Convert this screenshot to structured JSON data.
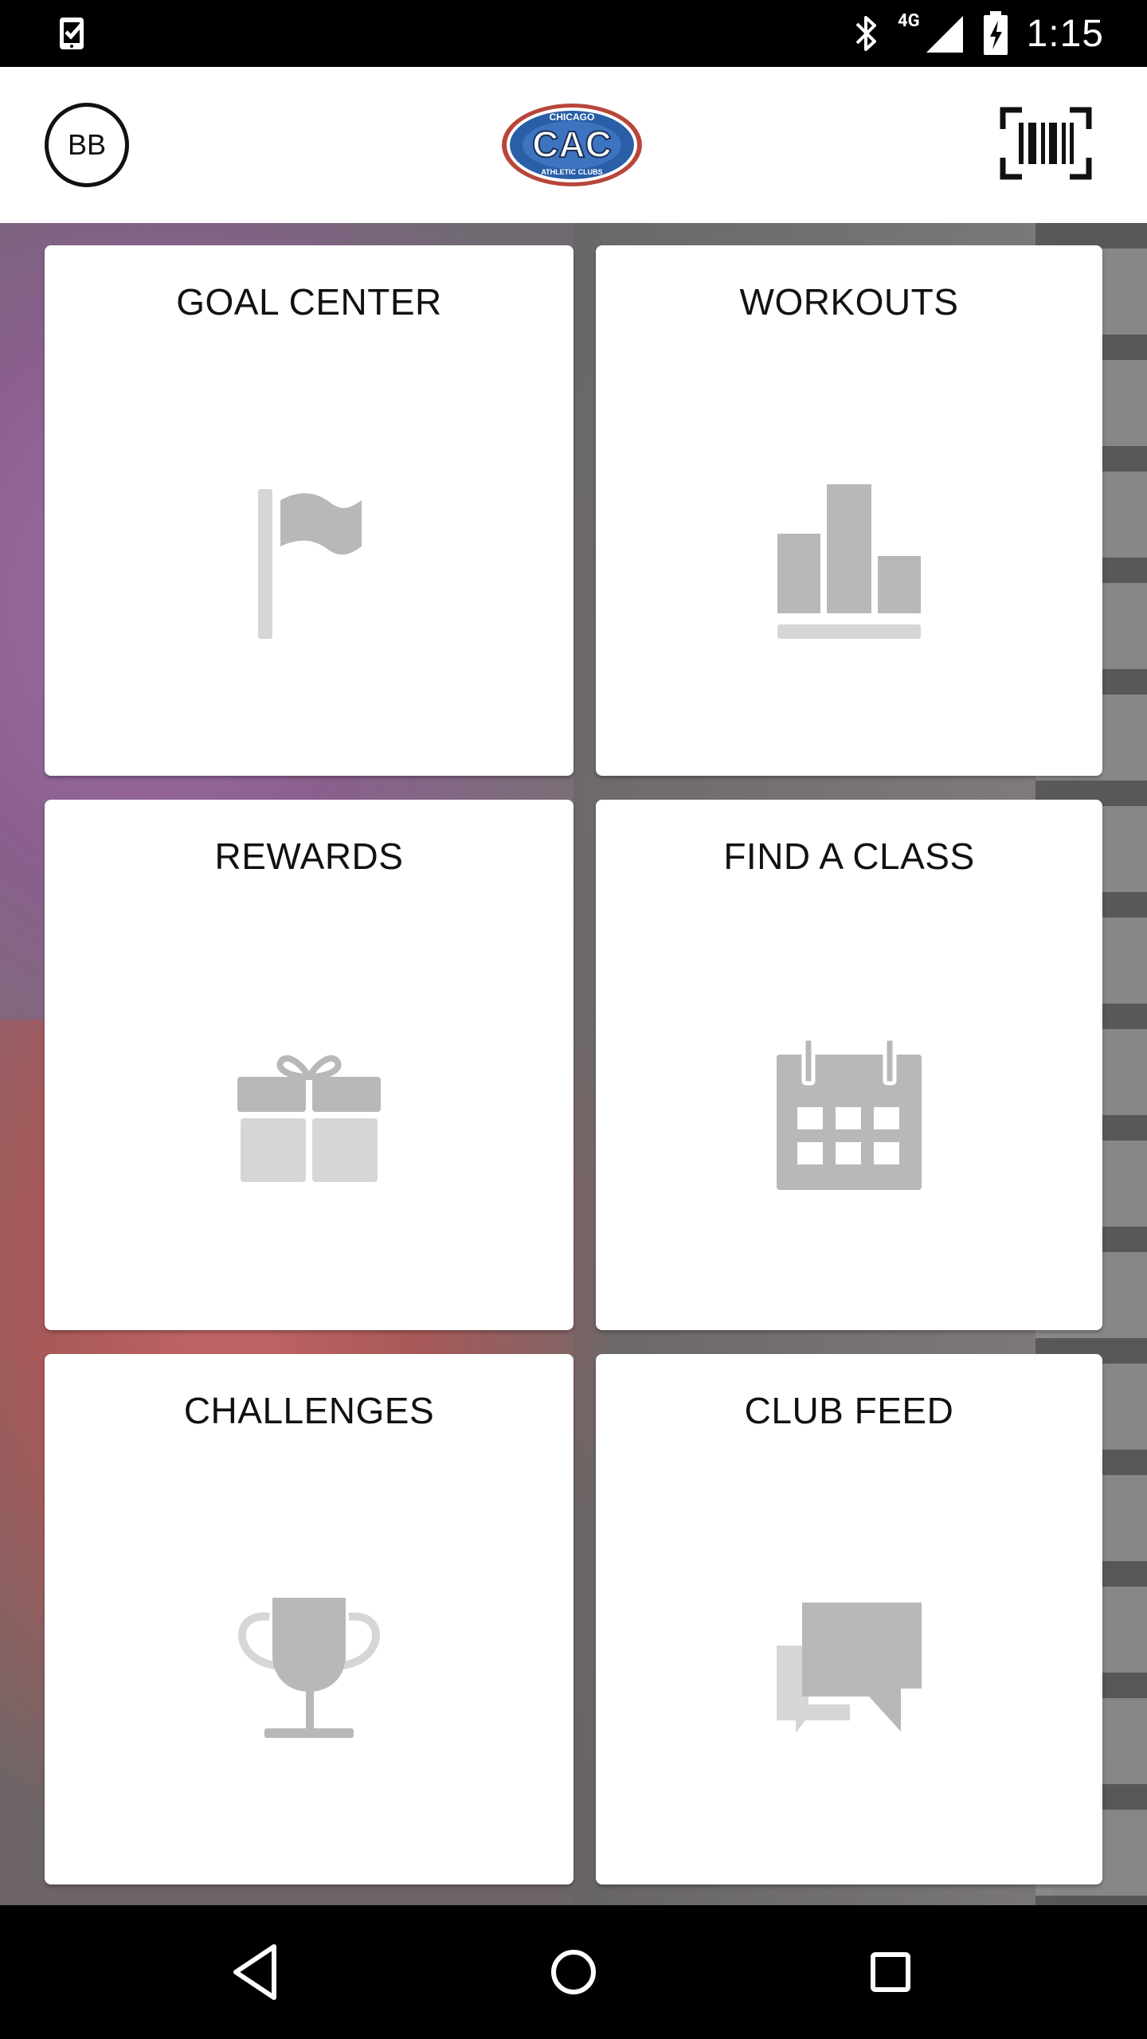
{
  "status_bar": {
    "time": "1:15",
    "network": "4G",
    "icons": [
      "task-check-icon",
      "bluetooth-icon",
      "signal-icon",
      "battery-charging-icon"
    ]
  },
  "header": {
    "avatar_initials": "BB",
    "logo": {
      "top_text": "CHICAGO",
      "main_text": "CAC",
      "bottom_text": "ATHLETIC CLUBS",
      "colors": {
        "blue": "#2a5fa8",
        "red": "#c0392b",
        "white": "#ffffff"
      }
    },
    "barcode_icon": "barcode-scan-icon"
  },
  "tiles": [
    {
      "title": "GOAL CENTER",
      "icon": "flag-icon"
    },
    {
      "title": "WORKOUTS",
      "icon": "bar-chart-icon"
    },
    {
      "title": "REWARDS",
      "icon": "gift-icon"
    },
    {
      "title": "FIND A CLASS",
      "icon": "calendar-icon"
    },
    {
      "title": "CHALLENGES",
      "icon": "trophy-icon"
    },
    {
      "title": "CLUB FEED",
      "icon": "chat-bubbles-icon"
    }
  ],
  "nav_bar": {
    "buttons": [
      "back-icon",
      "home-icon",
      "recents-icon"
    ]
  },
  "colors": {
    "icon_gray_dark": "#b8b8b8",
    "icon_gray_light": "#d6d6d6",
    "tile_bg": "#ffffff"
  }
}
